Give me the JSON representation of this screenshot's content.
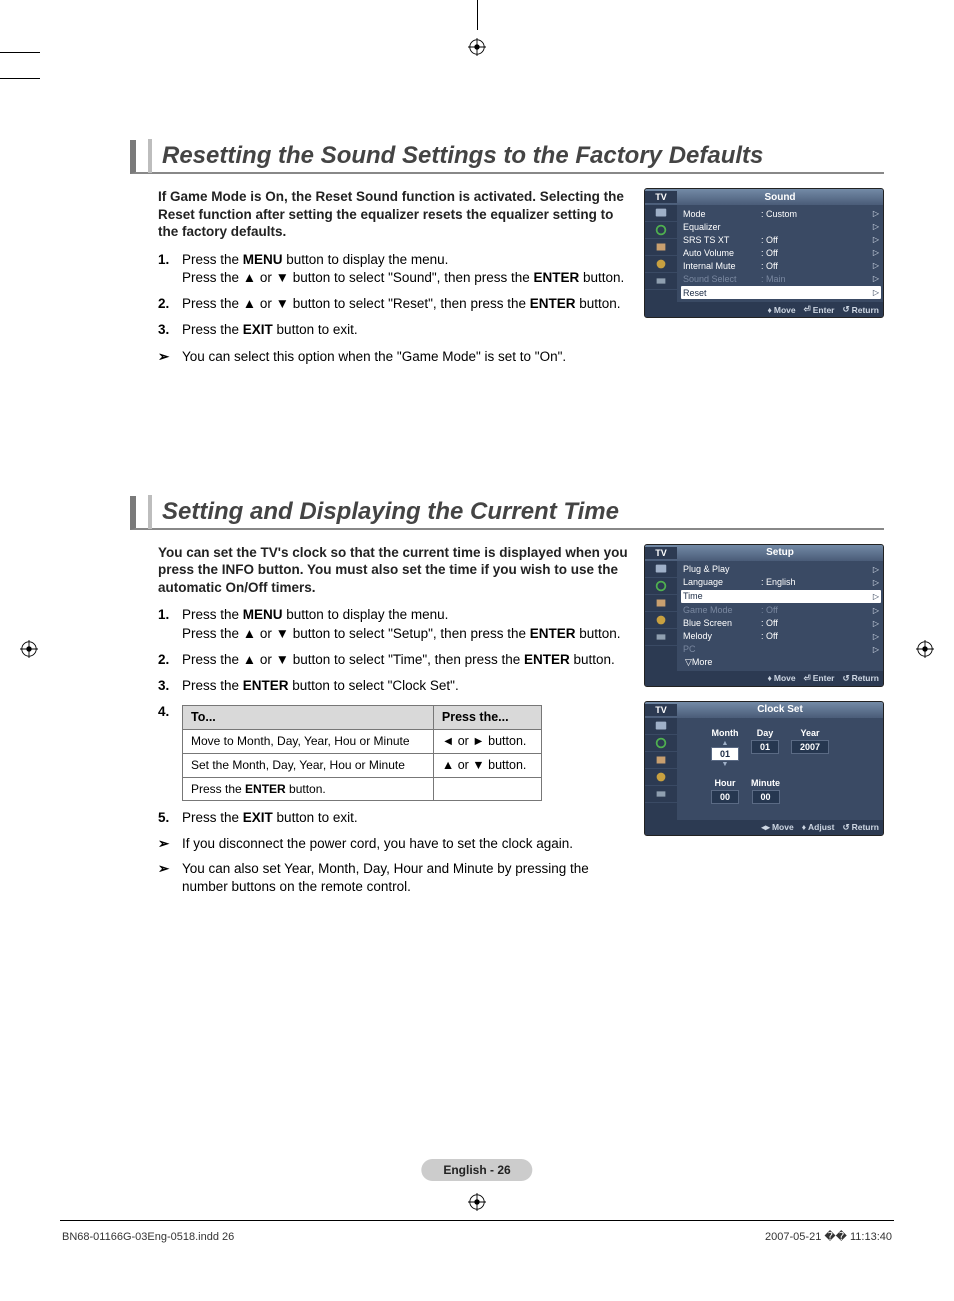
{
  "registration_glyph": "⊕",
  "section1": {
    "title": "Resetting the Sound Settings to the Factory Defaults",
    "intro": "If Game Mode is On, the Reset Sound function is activated. Selecting the Reset function after setting the equalizer resets the equalizer setting to the factory defaults.",
    "steps": {
      "n1": "1.",
      "s1a": "Press the ",
      "s1b": "MENU",
      "s1c": " button to display the menu.",
      "s1d": "Press the ▲ or ▼  button to select \"Sound\", then press the ",
      "s1e": "ENTER",
      "s1f": " button.",
      "n2": "2.",
      "s2a": "Press the ▲ or ▼ button to select \"Reset\", then press the ",
      "s2b": "ENTER",
      "s2c": " button.",
      "n3": "3.",
      "s3a": "Press the ",
      "s3b": "EXIT",
      "s3c": " button to exit."
    },
    "note_arrow": "➢",
    "note": "You can select this option when the \"Game Mode\" is set to \"On\"."
  },
  "section2": {
    "title": "Setting and Displaying the Current Time",
    "intro": "You can set the TV's clock so that the current time is displayed when you press the INFO button. You must also set the time if you wish to use the automatic On/Off timers.",
    "steps": {
      "n1": "1.",
      "s1a": "Press the ",
      "s1b": "MENU",
      "s1c": " button to display the menu.",
      "s1d": "Press the ▲ or ▼ button to select \"Setup\", then press the ",
      "s1e": "ENTER",
      "s1f": " button.",
      "n2": "2.",
      "s2a": "Press the ▲ or ▼ button to select \"Time\", then press the ",
      "s2b": "ENTER",
      "s2c": " button.",
      "n3": "3.",
      "s3a": "Press the ",
      "s3b": "ENTER",
      "s3c": " button to select \"Clock Set\".",
      "n4": "4.",
      "n5": "5.",
      "s5a": " Press the ",
      "s5b": "EXIT",
      "s5c": " button to exit."
    },
    "table": {
      "h1": "To...",
      "h2": "Press the...",
      "r1c1": "Move to Month, Day, Year, Hou or Minute",
      "r1c2": "◄ or ►  button.",
      "r2c1": "Set the Month, Day, Year, Hou or Minute",
      "r2c2": "▲ or ▼  button.",
      "r3a": "Press the ",
      "r3b": "ENTER",
      "r3c": " button."
    },
    "note_arrow": "➢",
    "note1": "If you disconnect the power cord, you have to set the clock again.",
    "note2": "You can also set Year, Month, Day, Hour and Minute by pressing the number buttons on the remote control."
  },
  "osd_sound": {
    "tv": "TV",
    "title": "Sound",
    "rows": [
      {
        "lbl": "Mode",
        "val": ": Custom",
        "sel": false,
        "dim": false
      },
      {
        "lbl": "Equalizer",
        "val": "",
        "sel": false,
        "dim": false
      },
      {
        "lbl": "SRS TS XT",
        "val": ": Off",
        "sel": false,
        "dim": false
      },
      {
        "lbl": "Auto Volume",
        "val": ": Off",
        "sel": false,
        "dim": false
      },
      {
        "lbl": "Internal Mute",
        "val": ": Off",
        "sel": false,
        "dim": false
      },
      {
        "lbl": "Sound Select",
        "val": ": Main",
        "sel": false,
        "dim": true
      },
      {
        "lbl": "Reset",
        "val": "",
        "sel": true,
        "dim": false
      }
    ],
    "footer": {
      "move": "Move",
      "enter": "Enter",
      "return": "Return"
    }
  },
  "osd_setup": {
    "tv": "TV",
    "title": "Setup",
    "rows": [
      {
        "lbl": "Plug & Play",
        "val": "",
        "sel": false,
        "dim": false
      },
      {
        "lbl": "Language",
        "val": ": English",
        "sel": false,
        "dim": false
      },
      {
        "lbl": "Time",
        "val": "",
        "sel": true,
        "dim": false
      },
      {
        "lbl": "Game Mode",
        "val": ": Off",
        "sel": false,
        "dim": true
      },
      {
        "lbl": "Blue Screen",
        "val": ": Off",
        "sel": false,
        "dim": false
      },
      {
        "lbl": "Melody",
        "val": ": Off",
        "sel": false,
        "dim": false
      },
      {
        "lbl": "PC",
        "val": "",
        "sel": false,
        "dim": true
      }
    ],
    "more": "▽More",
    "footer": {
      "move": "Move",
      "enter": "Enter",
      "return": "Return"
    }
  },
  "osd_clock": {
    "tv": "TV",
    "title": "Clock Set",
    "fields": {
      "month_lbl": "Month",
      "month": "01",
      "day_lbl": "Day",
      "day": "01",
      "year_lbl": "Year",
      "year": "2007",
      "hour_lbl": "Hour",
      "hour": "00",
      "minute_lbl": "Minute",
      "minute": "00"
    },
    "footer": {
      "move": "Move",
      "adjust": "Adjust",
      "return": "Return"
    }
  },
  "page_badge": "English - 26",
  "footer_left": "BN68-01166G-03Eng-0518.indd   26",
  "footer_right": "2007-05-21   �� 11:13:40"
}
